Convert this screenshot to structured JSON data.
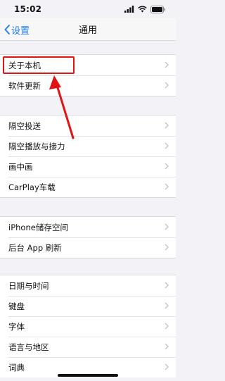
{
  "status_bar": {
    "time": "15:02"
  },
  "nav": {
    "back_label": "设置",
    "title": "通用"
  },
  "groups": [
    {
      "items": [
        "关于本机",
        "软件更新"
      ]
    },
    {
      "items": [
        "隔空投送",
        "隔空播放与接力",
        "画中画",
        "CarPlay车载"
      ]
    },
    {
      "items": [
        "iPhone储存空间",
        "后台 App 刷新"
      ]
    },
    {
      "items": [
        "日期与时间",
        "键盘",
        "字体",
        "语言与地区",
        "词典"
      ]
    }
  ],
  "annotation": {
    "highlighted_item": "关于本机",
    "color": "#e01414"
  },
  "colors": {
    "accent": "#1e7cf2",
    "background": "#f2f2f7"
  }
}
